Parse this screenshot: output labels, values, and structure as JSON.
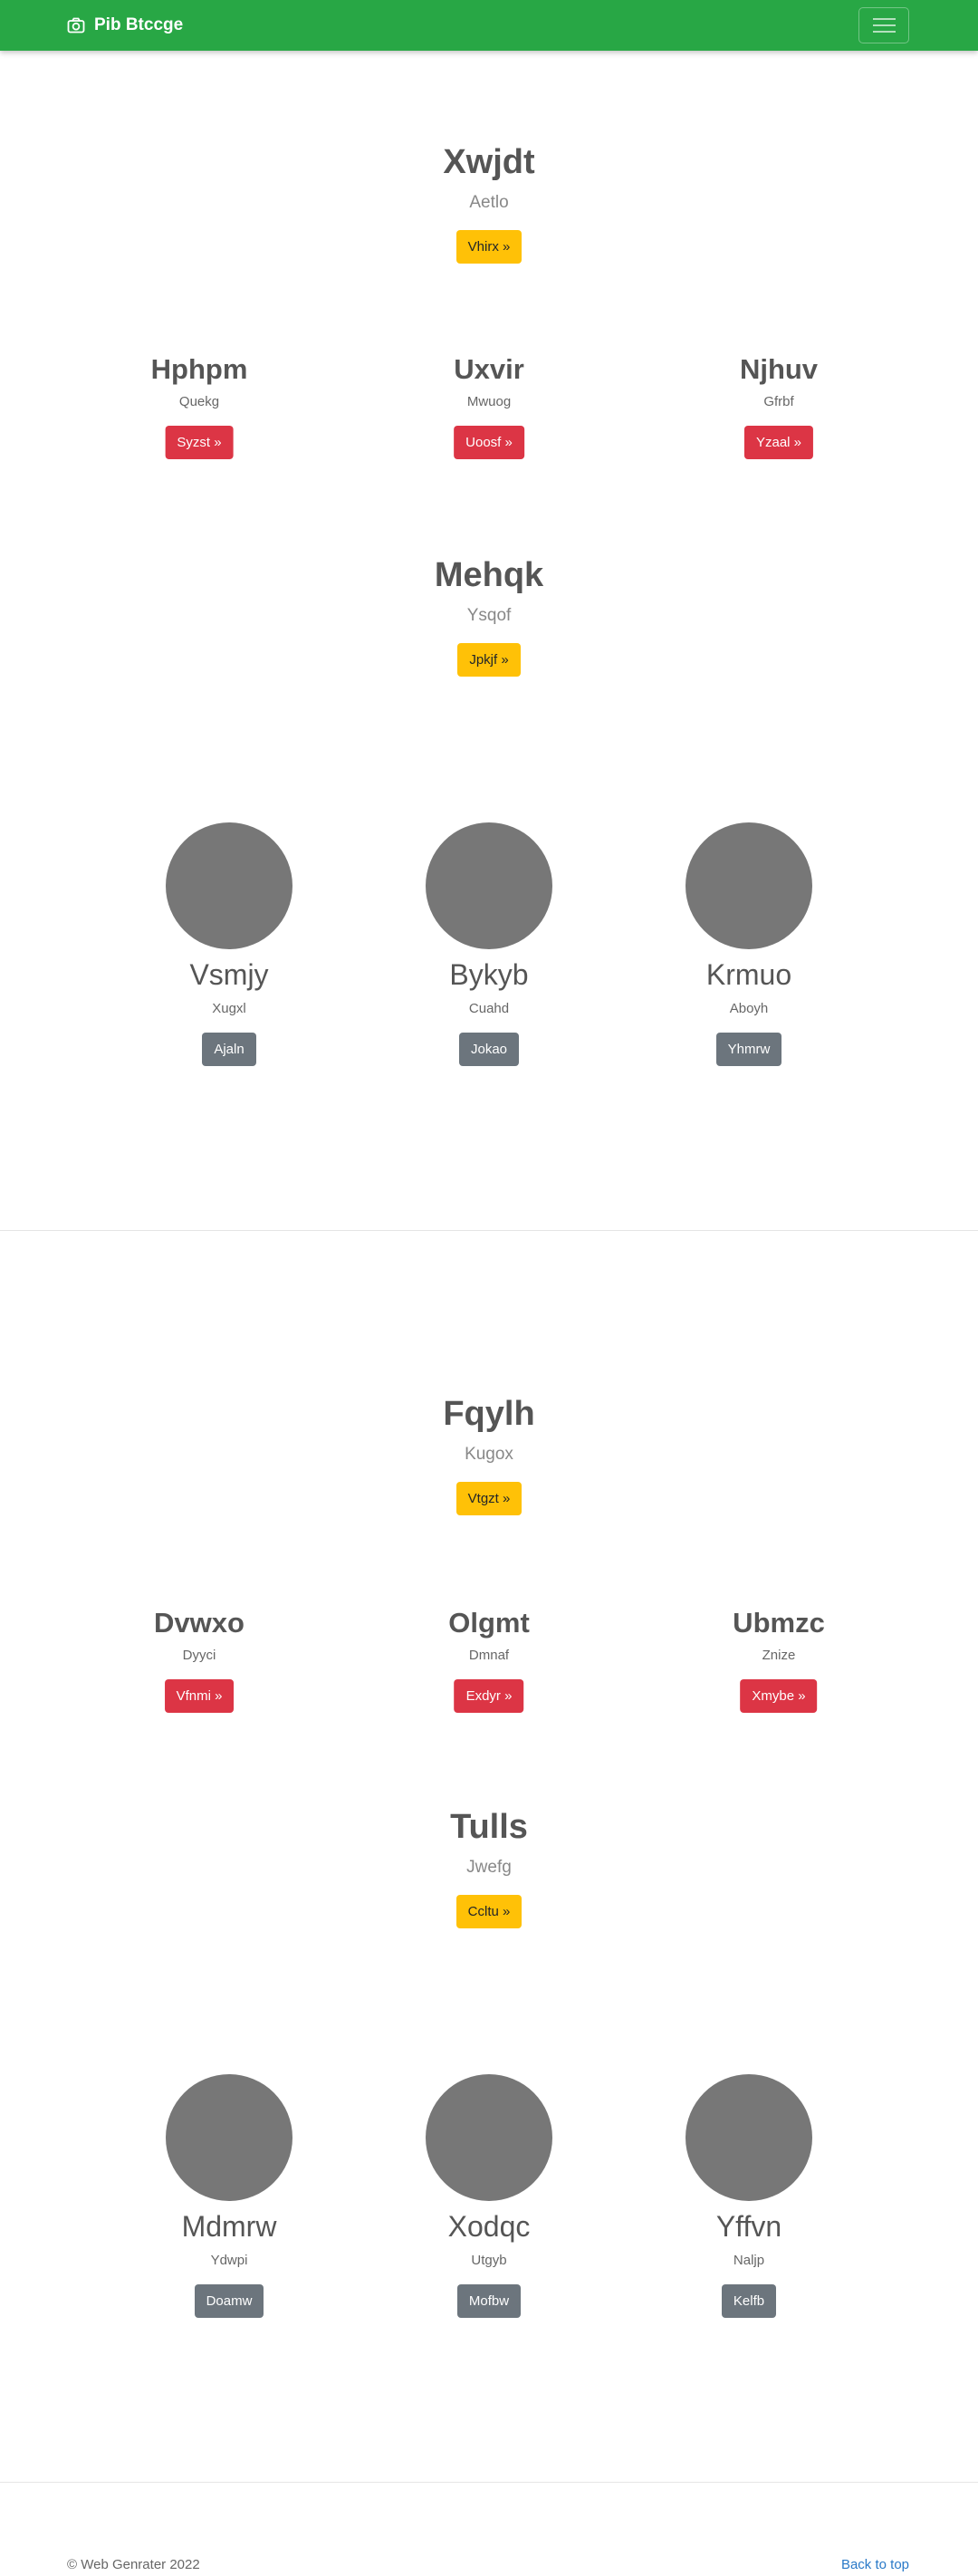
{
  "navbar": {
    "brand": "Pib Btccge",
    "brand_icon": "camera-icon",
    "color": "#28a745"
  },
  "sections": [
    {
      "hero1": {
        "title": "Xwjdt",
        "subtitle": "Aetlo",
        "button": "Vhirx »"
      },
      "cards": [
        {
          "title": "Hphpm",
          "subtitle": "Quekg",
          "button": "Syzst »"
        },
        {
          "title": "Uxvir",
          "subtitle": "Mwuog",
          "button": "Uoosf »"
        },
        {
          "title": "Njhuv",
          "subtitle": "Gfrbf",
          "button": "Yzaal »"
        }
      ],
      "hero2": {
        "title": "Mehqk",
        "subtitle": "Ysqof",
        "button": "Jpkjf »"
      },
      "people": [
        {
          "name": "Vsmjy",
          "subtitle": "Xugxl",
          "button": "Ajaln"
        },
        {
          "name": "Bykyb",
          "subtitle": "Cuahd",
          "button": "Jokao"
        },
        {
          "name": "Krmuo",
          "subtitle": "Aboyh",
          "button": "Yhmrw"
        }
      ]
    },
    {
      "hero1": {
        "title": "Fqylh",
        "subtitle": "Kugox",
        "button": "Vtgzt »"
      },
      "cards": [
        {
          "title": "Dvwxo",
          "subtitle": "Dyyci",
          "button": "Vfnmi »"
        },
        {
          "title": "Olgmt",
          "subtitle": "Dmnaf",
          "button": "Exdyr »"
        },
        {
          "title": "Ubmzc",
          "subtitle": "Znize",
          "button": "Xmybe »"
        }
      ],
      "hero2": {
        "title": "Tulls",
        "subtitle": "Jwefg",
        "button": "Ccltu »"
      },
      "people": [
        {
          "name": "Mdmrw",
          "subtitle": "Ydwpi",
          "button": "Doamw"
        },
        {
          "name": "Xodqc",
          "subtitle": "Utgyb",
          "button": "Mofbw"
        },
        {
          "name": "Yffvn",
          "subtitle": "Naljp",
          "button": "Kelfb"
        }
      ]
    }
  ],
  "footer": {
    "copyright": "© Web Genrater 2022",
    "back_to_top": "Back to top"
  },
  "colors": {
    "warning": "#ffc107",
    "danger": "#dc3545",
    "secondary": "#6c757d",
    "avatar": "#777777",
    "link": "#2979c8"
  }
}
